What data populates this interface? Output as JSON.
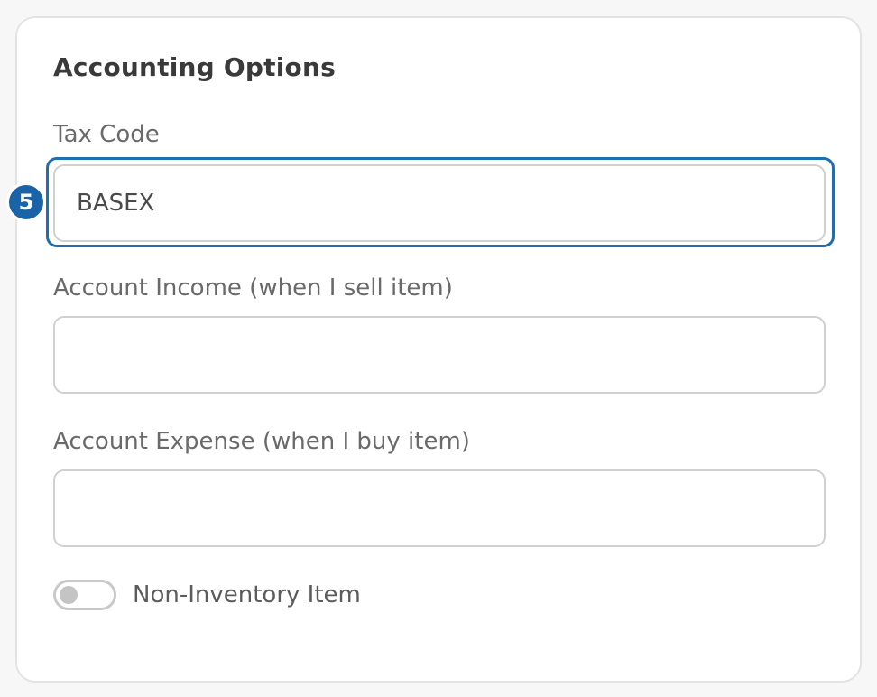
{
  "section": {
    "title": "Accounting Options"
  },
  "fields": {
    "tax_code": {
      "label": "Tax Code",
      "value": "BASEX"
    },
    "account_income": {
      "label": "Account Income (when I sell item)",
      "value": ""
    },
    "account_expense": {
      "label": "Account Expense (when I buy item)",
      "value": ""
    }
  },
  "step_badge": "5",
  "toggle": {
    "label": "Non-Inventory Item",
    "on": false
  },
  "colors": {
    "focus": "#1e6fb0",
    "badge": "#1a63a6"
  }
}
